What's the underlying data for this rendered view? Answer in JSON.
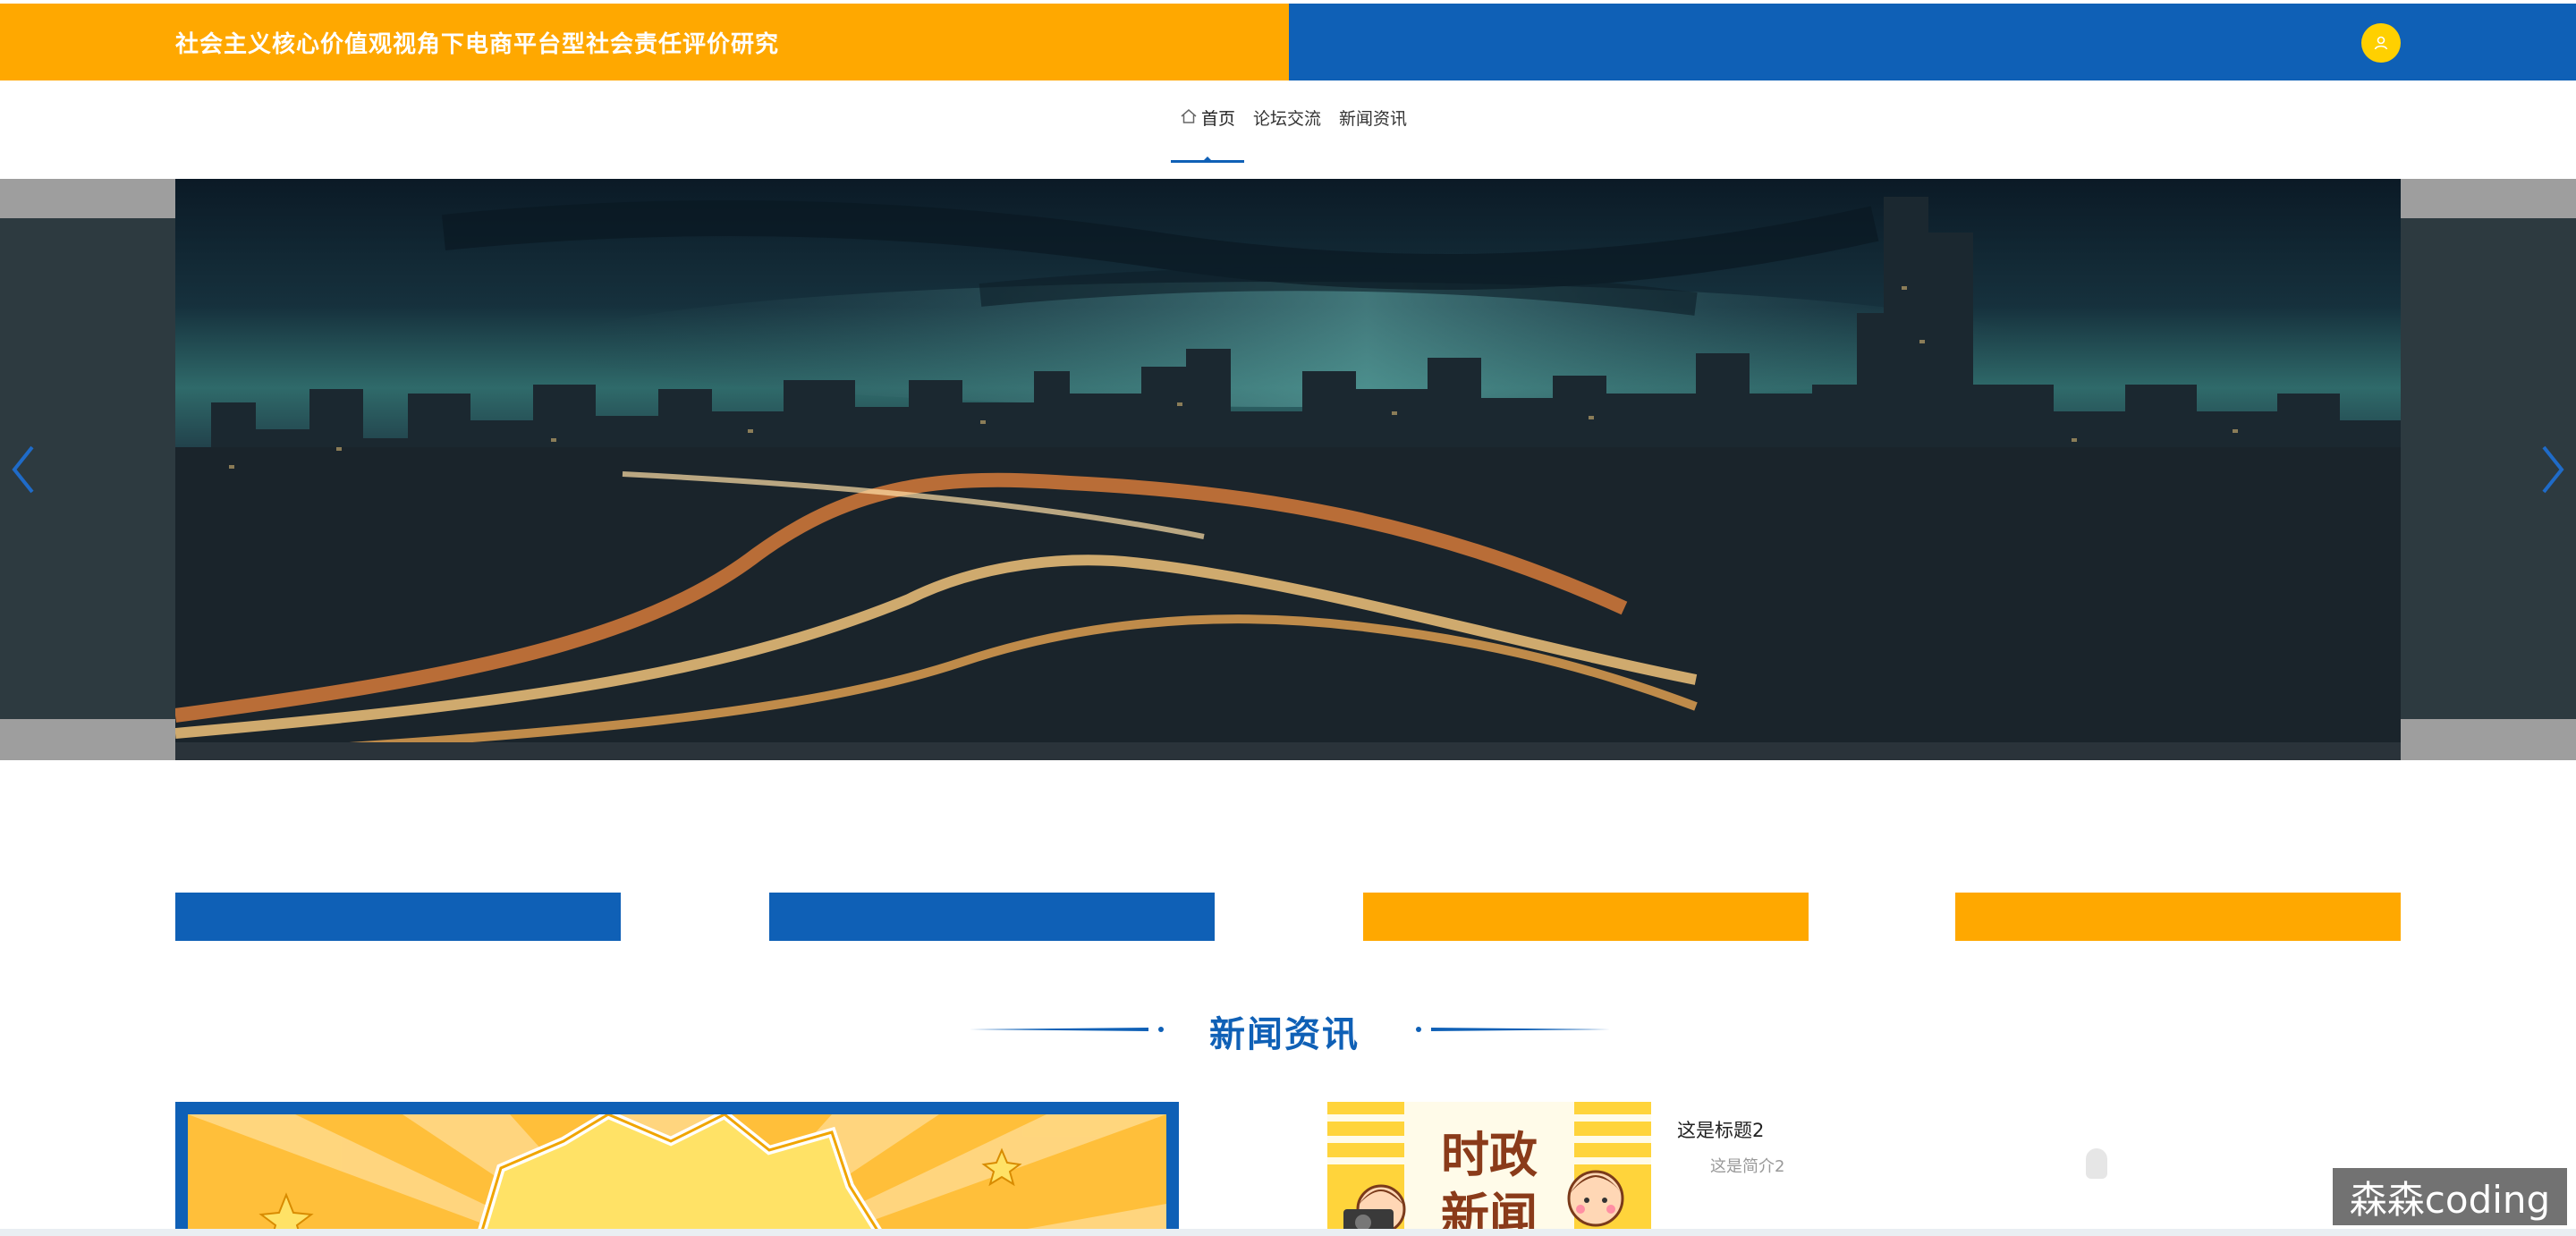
{
  "header": {
    "site_title": "社会主义核心价值观视角下电商平台型社会责任评价研究",
    "left_color": "#ffa800",
    "right_color": "#0f60b6",
    "avatar_icon": "user-icon"
  },
  "nav": {
    "items": [
      {
        "label": "首页",
        "icon": "home-icon",
        "active": true
      },
      {
        "label": "论坛交流",
        "active": false
      },
      {
        "label": "新闻资讯",
        "active": false
      }
    ]
  },
  "banner": {
    "prev_icon": "chevron-left-icon",
    "next_icon": "chevron-right-icon"
  },
  "feature_bars": [
    {
      "color": "#0f60b6"
    },
    {
      "color": "#0f60b6"
    },
    {
      "color": "#ffa800"
    },
    {
      "color": "#ffa800"
    }
  ],
  "news_section": {
    "title": "新闻资讯",
    "thumb_text_line1": "时政",
    "thumb_text_line2": "新闻",
    "items": [
      {
        "title": "这是标题2",
        "summary": "这是简介2"
      }
    ]
  },
  "watermark": {
    "text": "森森coding"
  }
}
